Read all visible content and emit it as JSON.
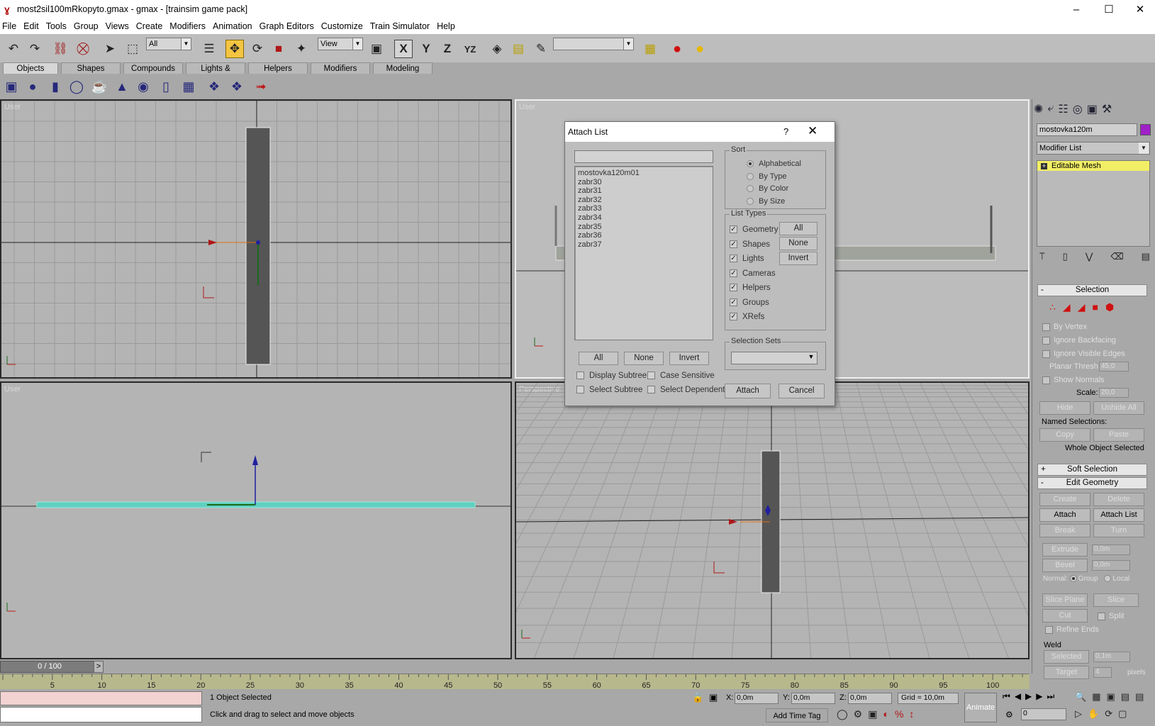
{
  "window": {
    "title": "most2sil100mRkopyto.gmax - gmax - [trainsim game pack]"
  },
  "menu": [
    "File",
    "Edit",
    "Tools",
    "Group",
    "Views",
    "Create",
    "Modifiers",
    "Animation",
    "Graph Editors",
    "Customize",
    "Train Simulator",
    "Help"
  ],
  "toolbar": {
    "selection_filter": "All",
    "coord_system": "View",
    "named_selection": ""
  },
  "create_tabs": [
    "Objects",
    "Shapes",
    "Compounds",
    "Lights & Cameras",
    "Helpers",
    "Modifiers",
    "Modeling"
  ],
  "viewports": {
    "top_left": "User",
    "top_right": "User",
    "bottom_left": "User",
    "bottom_right": "Perspective"
  },
  "panel": {
    "object_name": "mostovka120m",
    "object_color": "#a020c8",
    "modifier_list": "Modifier List",
    "stack_item": "Editable Mesh",
    "selection_title": "Selection",
    "by_vertex": "By Vertex",
    "ignore_backfacing": "Ignore Backfacing",
    "ignore_visible_edges": "Ignore Visible Edges",
    "planar_thresh_label": "Planar Thresh:",
    "planar_thresh_value": "45,0",
    "show_normals": "Show Normals",
    "scale_label": "Scale:",
    "scale_value": "20,0",
    "hide": "Hide",
    "unhide_all": "Unhide All",
    "named_selections": "Named Selections:",
    "copy": "Copy",
    "paste": "Paste",
    "whole_object": "Whole Object Selected",
    "soft_selection": "Soft Selection",
    "edit_geometry": "Edit Geometry",
    "create": "Create",
    "delete": "Delete",
    "attach": "Attach",
    "attach_list": "Attach List",
    "break": "Break",
    "turn": "Turn",
    "extrude": "Extrude",
    "extrude_value": "0,0m",
    "bevel": "Bevel",
    "bevel_value": "0,0m",
    "normal_label": "Normal:",
    "group": "Group",
    "local": "Local",
    "slice_plane": "Slice Plane",
    "slice": "Slice",
    "cut": "Cut",
    "split": "Split",
    "refine_ends": "Refine Ends",
    "weld": "Weld",
    "selected": "Selected",
    "selected_value": "0,1m",
    "target": "Target",
    "target_value": "4",
    "pixels": "pixels"
  },
  "dialog": {
    "title": "Attach List",
    "help": "?",
    "filter_text": "",
    "objects": [
      "mostovka120m01",
      "zabr30",
      "zabr31",
      "zabr32",
      "zabr33",
      "zabr34",
      "zabr35",
      "zabr36",
      "zabr37"
    ],
    "sort_label": "Sort",
    "sort_options": [
      "Alphabetical",
      "By Type",
      "By Color",
      "By Size"
    ],
    "list_types_label": "List Types",
    "list_types": [
      "Geometry",
      "Shapes",
      "Lights",
      "Cameras",
      "Helpers",
      "Groups",
      "XRefs"
    ],
    "all": "All",
    "none": "None",
    "invert": "Invert",
    "selection_sets_label": "Selection Sets",
    "display_subtree": "Display Subtree",
    "case_sensitive": "Case Sensitive",
    "select_subtree": "Select Subtree",
    "select_dependents": "Select Dependents",
    "attach": "Attach",
    "cancel": "Cancel"
  },
  "timeline": {
    "frame_display": "0 / 100",
    "ticks": [
      "5",
      "10",
      "15",
      "20",
      "25",
      "30",
      "35",
      "40",
      "45",
      "50",
      "55",
      "60",
      "65",
      "70",
      "75",
      "80",
      "85",
      "90",
      "95",
      "100"
    ]
  },
  "status": {
    "selected_count": "1 Object Selected",
    "prompt": "Click and drag to select and move objects",
    "x_label": "X:",
    "x_value": "0,0m",
    "y_label": "Y:",
    "y_value": "0,0m",
    "z_label": "Z:",
    "z_value": "0,0m",
    "grid": "Grid = 10,0m",
    "add_time_tag": "Add Time Tag",
    "animate": "Animate",
    "frame": "0"
  }
}
